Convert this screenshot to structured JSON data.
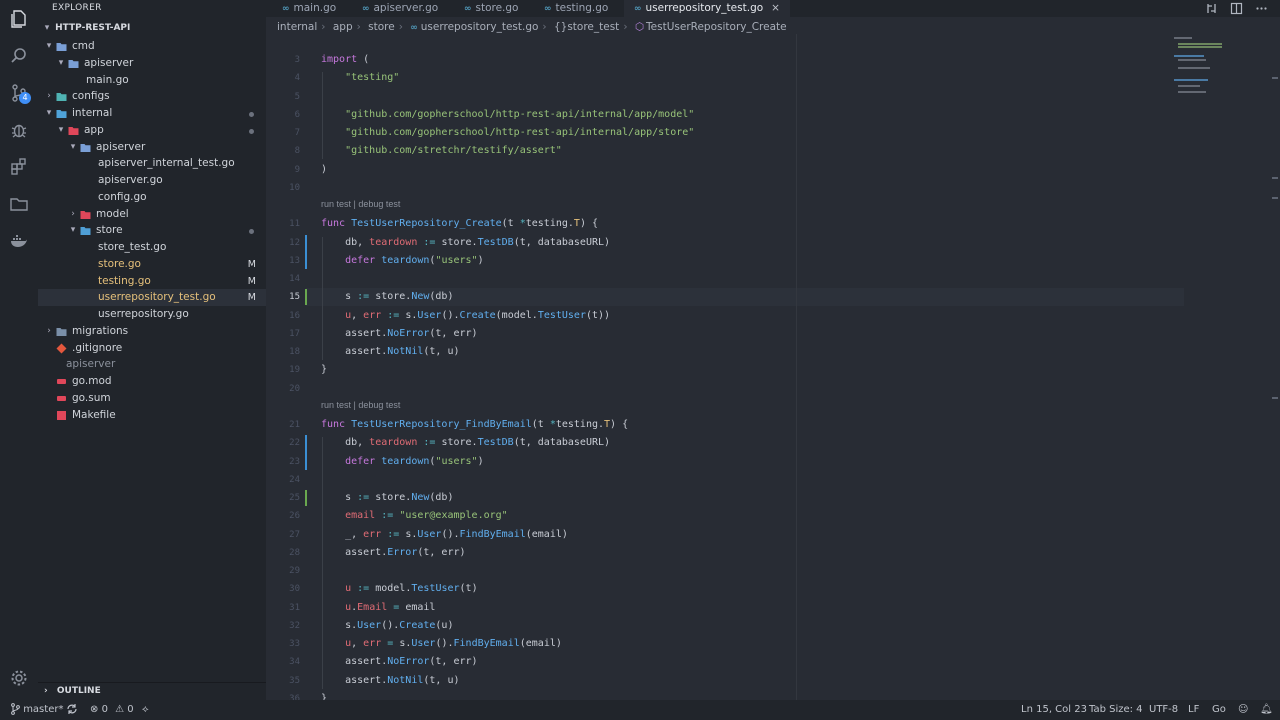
{
  "activity_bar": {
    "scm_badge": "4",
    "icons": [
      "files-icon",
      "search-icon",
      "source-control-icon",
      "debug-icon",
      "extensions-icon",
      "folder-icon",
      "docker-icon"
    ]
  },
  "sidebar": {
    "title": "EXPLORER",
    "root": "HTTP-REST-API",
    "tree": [
      {
        "label": "cmd",
        "kind": "folder",
        "expanded": true,
        "depth": 1
      },
      {
        "label": "apiserver",
        "kind": "folder",
        "expanded": true,
        "depth": 2
      },
      {
        "label": "main.go",
        "kind": "file",
        "depth": 3
      },
      {
        "label": "configs",
        "kind": "folder",
        "expanded": false,
        "depth": 1
      },
      {
        "label": "internal",
        "kind": "folder",
        "expanded": true,
        "depth": 1,
        "dot": true
      },
      {
        "label": "app",
        "kind": "folder",
        "expanded": true,
        "depth": 2,
        "dot": true
      },
      {
        "label": "apiserver",
        "kind": "folder",
        "expanded": true,
        "depth": 3
      },
      {
        "label": "apiserver_internal_test.go",
        "kind": "file",
        "depth": 4
      },
      {
        "label": "apiserver.go",
        "kind": "file",
        "depth": 4
      },
      {
        "label": "config.go",
        "kind": "file",
        "depth": 4
      },
      {
        "label": "model",
        "kind": "folder",
        "expanded": false,
        "depth": 3
      },
      {
        "label": "store",
        "kind": "folder",
        "expanded": true,
        "depth": 3,
        "dot": true
      },
      {
        "label": "store_test.go",
        "kind": "file",
        "depth": 4
      },
      {
        "label": "store.go",
        "kind": "file",
        "depth": 4,
        "mod": "M"
      },
      {
        "label": "testing.go",
        "kind": "file",
        "depth": 4,
        "mod": "M"
      },
      {
        "label": "userrepository_test.go",
        "kind": "file",
        "depth": 4,
        "mod": "M",
        "selected": true
      },
      {
        "label": "userrepository.go",
        "kind": "file",
        "depth": 4
      },
      {
        "label": "migrations",
        "kind": "folder",
        "expanded": false,
        "depth": 1
      },
      {
        "label": ".gitignore",
        "kind": "git",
        "depth": 1
      },
      {
        "label": "apiserver",
        "kind": "binary",
        "depth": 1
      },
      {
        "label": "go.mod",
        "kind": "mod",
        "depth": 1
      },
      {
        "label": "go.sum",
        "kind": "mod",
        "depth": 1
      },
      {
        "label": "Makefile",
        "kind": "make",
        "depth": 1
      }
    ],
    "outline_title": "OUTLINE"
  },
  "tabs": [
    {
      "label": "main.go",
      "active": false
    },
    {
      "label": "apiserver.go",
      "active": false
    },
    {
      "label": "store.go",
      "active": false
    },
    {
      "label": "testing.go",
      "active": false
    },
    {
      "label": "userrepository_test.go",
      "active": true
    }
  ],
  "breadcrumb": {
    "parts": [
      "internal",
      "app",
      "store",
      "userrepository_test.go"
    ],
    "package": "{}store_test",
    "symbol": "TestUserRepository_Create"
  },
  "code": {
    "codelens": "run test | debug test",
    "lines": [
      {
        "n": "3",
        "t": "import ("
      },
      {
        "n": "4",
        "t": "    \"testing\""
      },
      {
        "n": "5",
        "t": ""
      },
      {
        "n": "6",
        "t": "    \"github.com/gopherschool/http-rest-api/internal/app/model\""
      },
      {
        "n": "7",
        "t": "    \"github.com/gopherschool/http-rest-api/internal/app/store\""
      },
      {
        "n": "8",
        "t": "    \"github.com/stretchr/testify/assert\""
      },
      {
        "n": "9",
        "t": ")"
      },
      {
        "n": "10",
        "t": ""
      },
      {
        "n": "11",
        "t": "func TestUserRepository_Create(t *testing.T) {"
      },
      {
        "n": "12",
        "t": "    db, teardown := store.TestDB(t, databaseURL)"
      },
      {
        "n": "13",
        "t": "    defer teardown(\"users\")"
      },
      {
        "n": "14",
        "t": ""
      },
      {
        "n": "15",
        "t": "    s := store.New(db)"
      },
      {
        "n": "16",
        "t": "    u, err := s.User().Create(model.TestUser(t))"
      },
      {
        "n": "17",
        "t": "    assert.NoError(t, err)"
      },
      {
        "n": "18",
        "t": "    assert.NotNil(t, u)"
      },
      {
        "n": "19",
        "t": "}"
      },
      {
        "n": "20",
        "t": ""
      },
      {
        "n": "21",
        "t": "func TestUserRepository_FindByEmail(t *testing.T) {"
      },
      {
        "n": "22",
        "t": "    db, teardown := store.TestDB(t, databaseURL)"
      },
      {
        "n": "23",
        "t": "    defer teardown(\"users\")"
      },
      {
        "n": "24",
        "t": ""
      },
      {
        "n": "25",
        "t": "    s := store.New(db)"
      },
      {
        "n": "26",
        "t": "    email := \"user@example.org\""
      },
      {
        "n": "27",
        "t": "    _, err := s.User().FindByEmail(email)"
      },
      {
        "n": "28",
        "t": "    assert.Error(t, err)"
      },
      {
        "n": "29",
        "t": ""
      },
      {
        "n": "30",
        "t": "    u := model.TestUser(t)"
      },
      {
        "n": "31",
        "t": "    u.Email = email"
      },
      {
        "n": "32",
        "t": "    s.User().Create(u)"
      },
      {
        "n": "33",
        "t": "    u, err = s.User().FindByEmail(email)"
      },
      {
        "n": "34",
        "t": "    assert.NoError(t, err)"
      },
      {
        "n": "35",
        "t": "    assert.NotNil(t, u)"
      },
      {
        "n": "36",
        "t": "}"
      }
    ]
  },
  "status": {
    "branch": "master*",
    "errors": "0",
    "warnings": "0",
    "position": "Ln 15, Col 23",
    "tab_size": "Tab Size: 4",
    "encoding": "UTF-8",
    "eol": "LF",
    "language": "Go"
  },
  "colors": {
    "keyword": "#c678dd",
    "function": "#61afef",
    "string": "#98c379",
    "variable": "#e06c75",
    "operator": "#56b6c2",
    "type": "#e5c07b",
    "badge": "#3f8ff7"
  }
}
